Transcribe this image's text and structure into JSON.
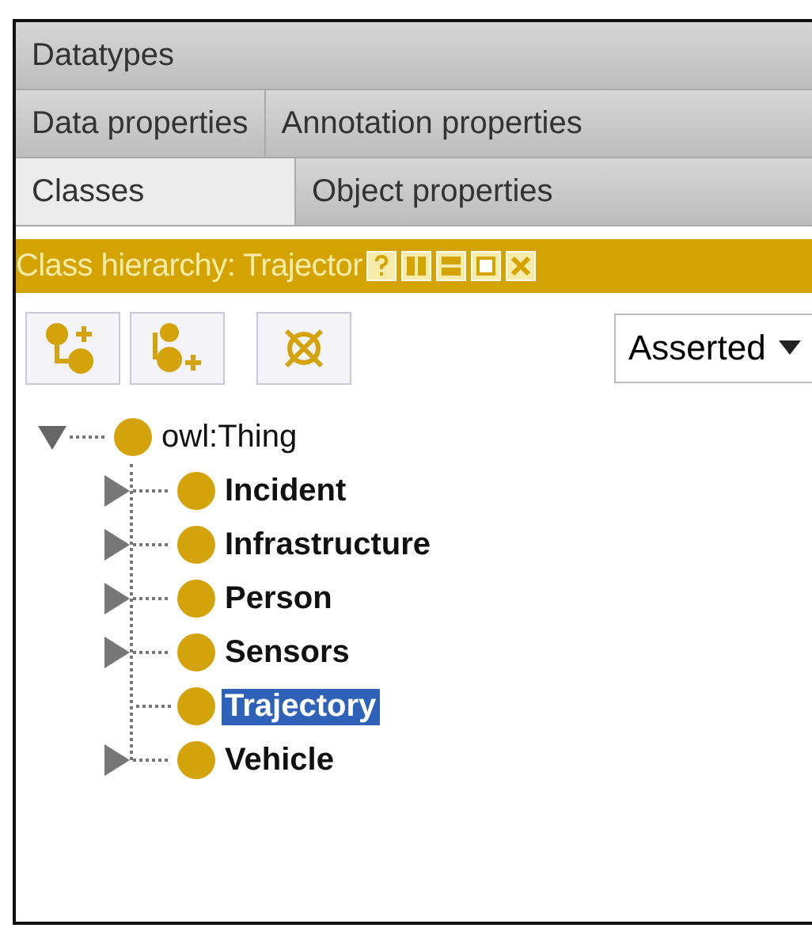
{
  "tab_rows": [
    [
      {
        "label": "Datatypes",
        "selected": false
      }
    ],
    [
      {
        "label": "Data properties",
        "selected": false
      },
      {
        "label": "Annotation properties",
        "selected": false
      }
    ],
    [
      {
        "label": "Classes",
        "selected": true
      },
      {
        "label": "Object properties",
        "selected": false
      }
    ]
  ],
  "view": {
    "title": "Class hierarchy: Trajector"
  },
  "toolbar": {
    "dropdown": "Asserted"
  },
  "tree": {
    "label": "owl:Thing",
    "expanded": true,
    "selected": false,
    "children": [
      {
        "label": "Incident",
        "kind": "branch",
        "expanded": false,
        "selected": false
      },
      {
        "label": "Infrastructure",
        "kind": "branch",
        "expanded": false,
        "selected": false
      },
      {
        "label": "Person",
        "kind": "branch",
        "expanded": false,
        "selected": false
      },
      {
        "label": "Sensors",
        "kind": "branch",
        "expanded": false,
        "selected": false
      },
      {
        "label": "Trajectory",
        "kind": "leaf",
        "selected": true
      },
      {
        "label": "Vehicle",
        "kind": "branch",
        "expanded": false,
        "selected": false
      }
    ]
  }
}
